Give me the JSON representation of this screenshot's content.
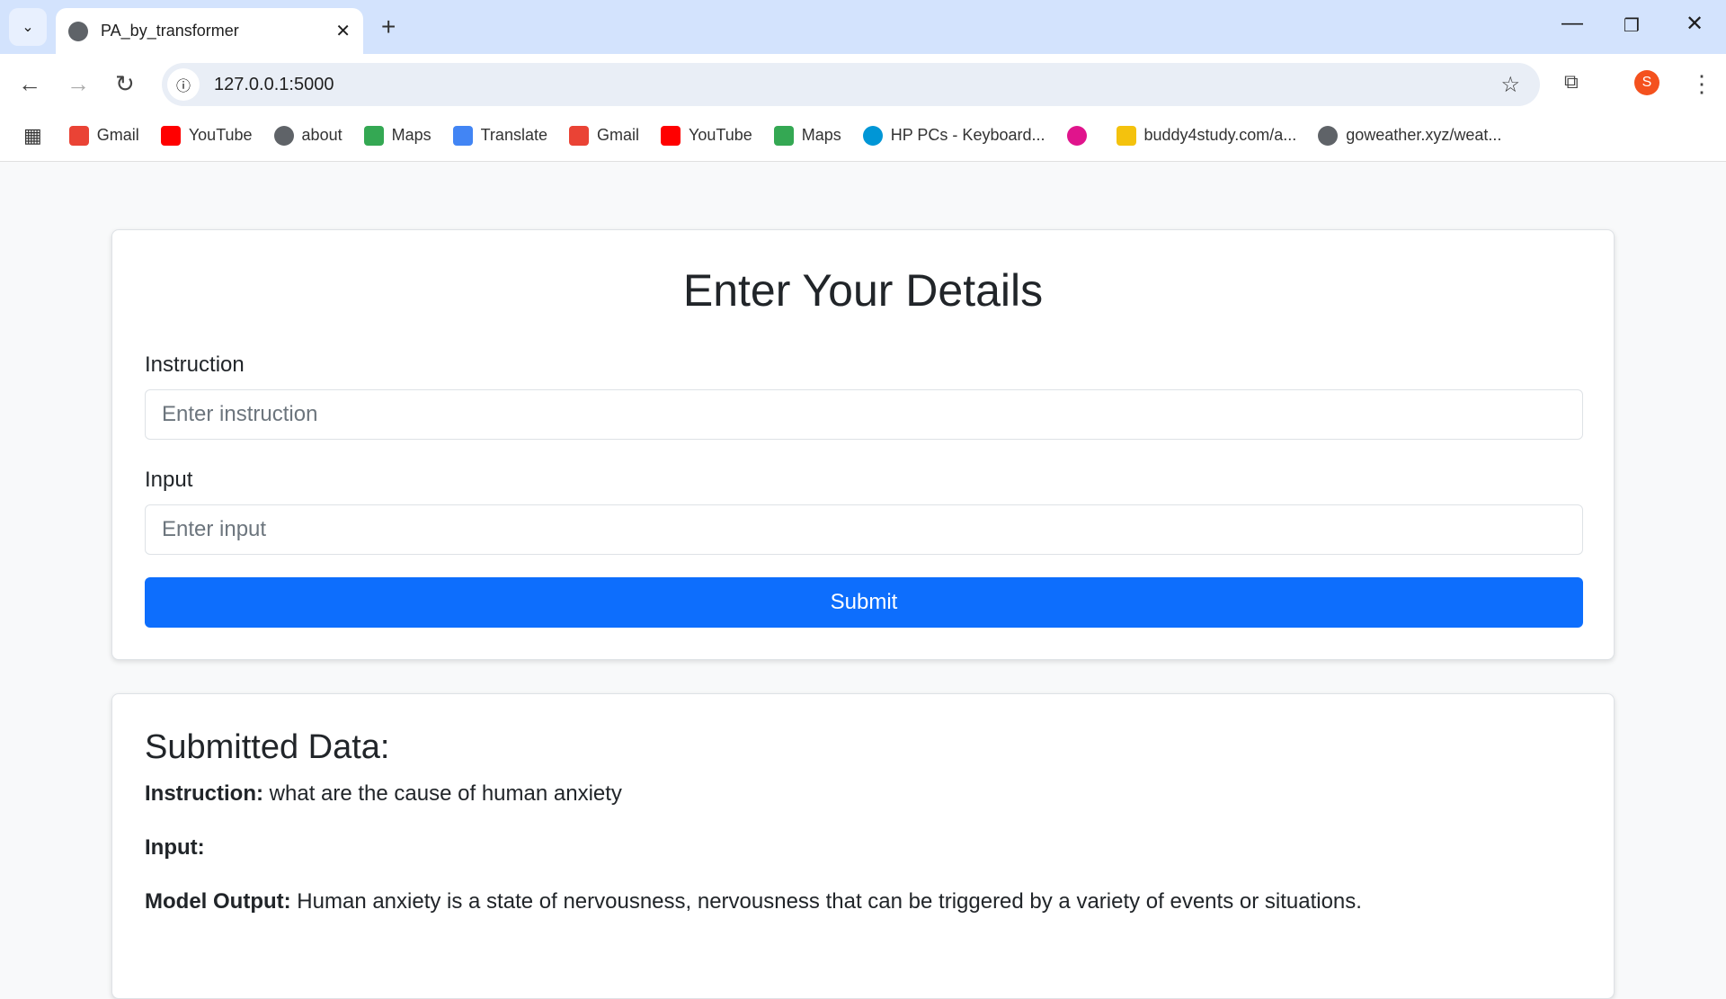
{
  "browser": {
    "tab_title": "PA_by_transformer",
    "url": "127.0.0.1:5000",
    "profile_initial": "S",
    "bookmarks": [
      {
        "label": "Gmail",
        "icon": "gmail-icon",
        "color": "#ea4335"
      },
      {
        "label": "YouTube",
        "icon": "youtube-icon",
        "color": "#ff0000"
      },
      {
        "label": "about",
        "icon": "globe-icon",
        "color": "#5f6368"
      },
      {
        "label": "Maps",
        "icon": "maps-icon",
        "color": "#34a853"
      },
      {
        "label": "Translate",
        "icon": "translate-icon",
        "color": "#4285f4"
      },
      {
        "label": "Gmail",
        "icon": "gmail-icon",
        "color": "#ea4335"
      },
      {
        "label": "YouTube",
        "icon": "youtube-icon",
        "color": "#ff0000"
      },
      {
        "label": "Maps",
        "icon": "maps-icon",
        "color": "#34a853"
      },
      {
        "label": "HP PCs - Keyboard...",
        "icon": "hp-icon",
        "color": "#0096d6"
      },
      {
        "label": "",
        "icon": "clapper-icon",
        "color": "#e0148c"
      },
      {
        "label": "buddy4study.com/a...",
        "icon": "graduate-icon",
        "color": "#f4c20d"
      },
      {
        "label": "goweather.xyz/weat...",
        "icon": "globe-icon",
        "color": "#5f6368"
      }
    ]
  },
  "form": {
    "title": "Enter Your Details",
    "instruction_label": "Instruction",
    "instruction_placeholder": "Enter instruction",
    "input_label": "Input",
    "input_placeholder": "Enter input",
    "submit_label": "Submit",
    "accent": "#0d6efd"
  },
  "result": {
    "title": "Submitted Data:",
    "instruction_label": "Instruction:",
    "instruction_value": "what are the cause of human anxiety",
    "input_label": "Input:",
    "input_value": "",
    "output_label": "Model Output:",
    "output_value": "Human anxiety is a state of nervousness, nervousness that can be triggered by a variety of events or situations."
  }
}
